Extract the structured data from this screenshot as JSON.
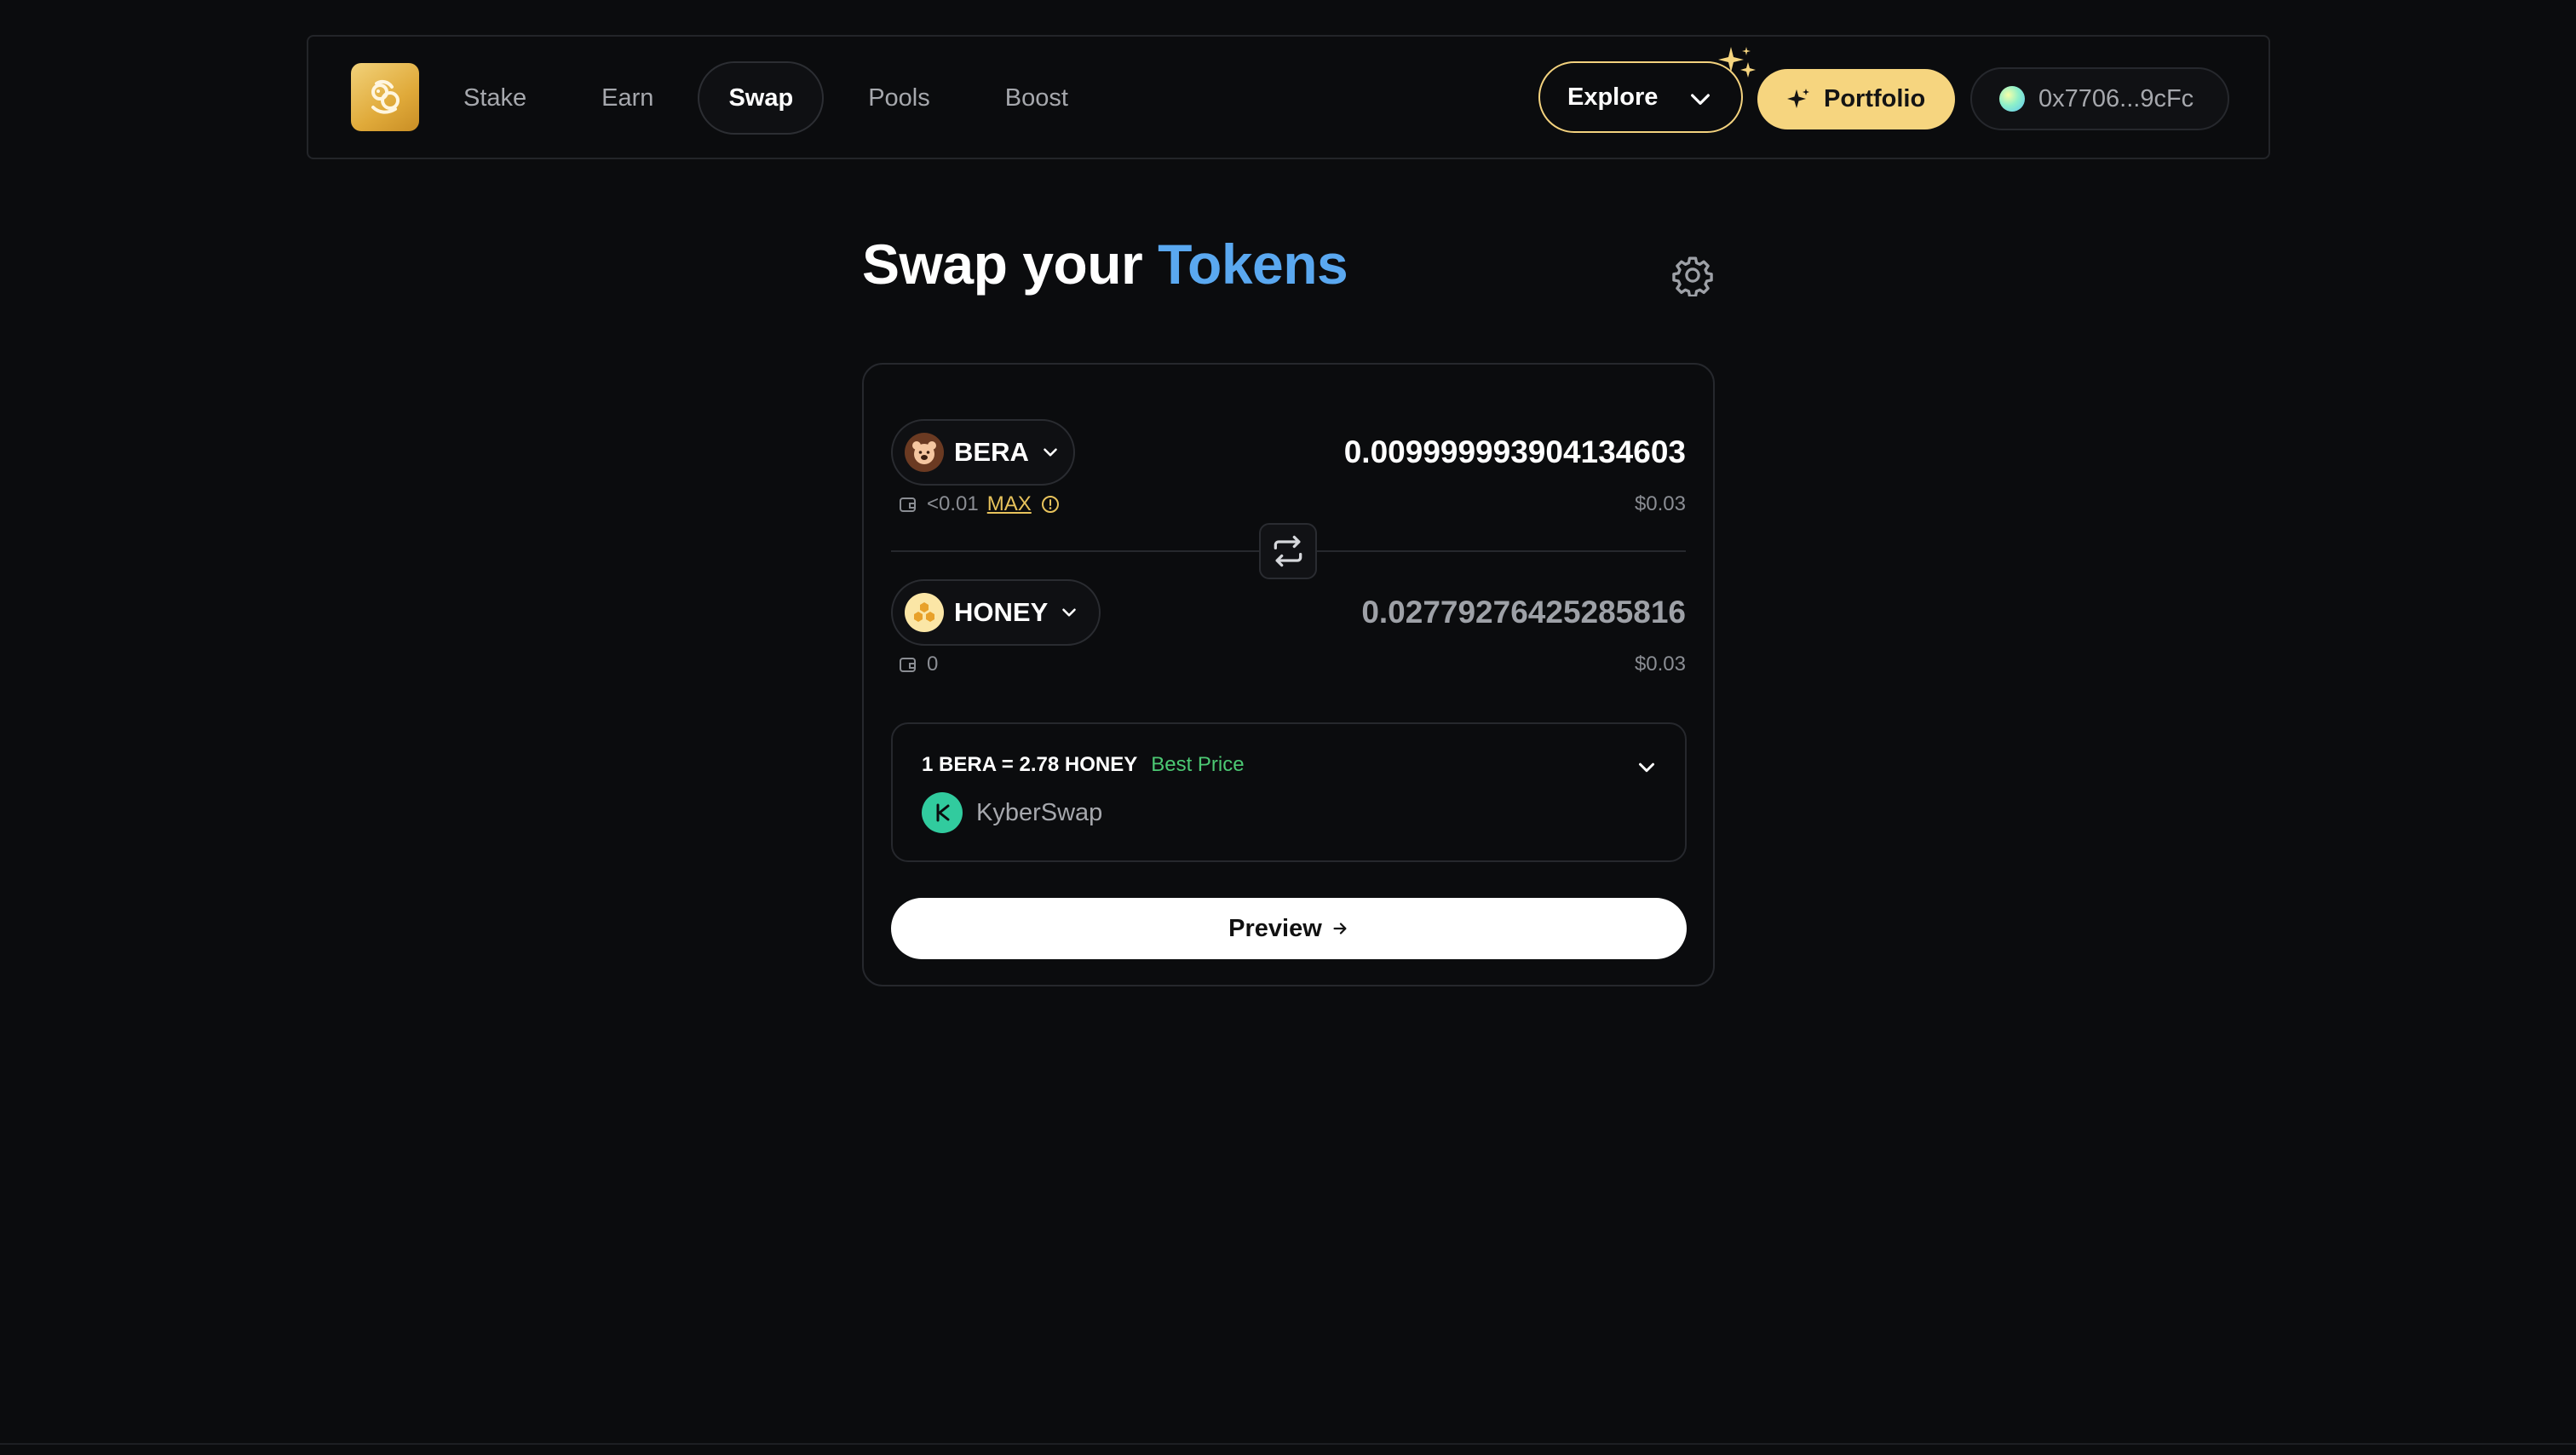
{
  "nav": {
    "links": [
      {
        "label": "Stake"
      },
      {
        "label": "Earn"
      },
      {
        "label": "Swap",
        "active": true
      },
      {
        "label": "Pools"
      },
      {
        "label": "Boost"
      }
    ],
    "explore_label": "Explore",
    "portfolio_label": "Portfolio",
    "wallet_address": "0x7706...9cFc"
  },
  "heading": {
    "prefix": "Swap your",
    "accent": "Tokens"
  },
  "swap": {
    "from": {
      "symbol": "BERA",
      "amount": "0.009999993904134603",
      "usd": "$0.03",
      "balance": "<0.01",
      "max_label": "MAX"
    },
    "to": {
      "symbol": "HONEY",
      "amount": "0.02779276425285816",
      "usd": "$0.03",
      "balance": "0"
    },
    "rate": "1 BERA = 2.78 HONEY",
    "rate_badge": "Best Price",
    "dex": "KyberSwap",
    "preview_label": "Preview"
  },
  "colors": {
    "background": "#0b0c0e",
    "accent_blue": "#5aa8f0",
    "accent_gold": "#f6d57f",
    "best_price_green": "#4cc873",
    "kyber_green": "#31cb9e"
  }
}
